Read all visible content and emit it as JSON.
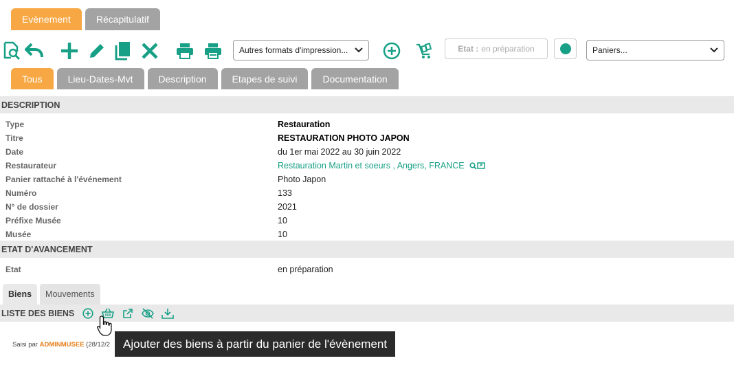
{
  "top_tabs": [
    {
      "label": "Evènement",
      "active": true
    },
    {
      "label": "Récapitulatif",
      "active": false
    }
  ],
  "toolbar": {
    "print_formats_label": "Autres formats d'impression...",
    "etat_label": "Etat :",
    "etat_value": "en préparation",
    "paniers_label": "Paniers..."
  },
  "sub_tabs": [
    {
      "label": "Tous",
      "active": true
    },
    {
      "label": "Lieu-Dates-Mvt",
      "active": false
    },
    {
      "label": "Description",
      "active": false
    },
    {
      "label": "Etapes de suivi",
      "active": false
    },
    {
      "label": "Documentation",
      "active": false
    }
  ],
  "description": {
    "header": "DESCRIPTION",
    "rows": [
      {
        "label": "Type",
        "value": "Restauration"
      },
      {
        "label": "Titre",
        "value": "RESTAURATION PHOTO JAPON"
      },
      {
        "label": "Date",
        "value": "du 1er mai 2022 au 30 juin 2022"
      },
      {
        "label": "Restaurateur",
        "value": "Restauration Martin et soeurs , Angers, FRANCE"
      },
      {
        "label": "Panier rattaché à l'événement",
        "value": "Photo Japon"
      },
      {
        "label": "Numéro",
        "value": "133"
      },
      {
        "label": "N° de dossier",
        "value": "2021"
      },
      {
        "label": "Préfixe Musée",
        "value": "10"
      },
      {
        "label": "Musée",
        "value": "10"
      }
    ]
  },
  "avancement": {
    "header": "ETAT D'AVANCEMENT",
    "rows": [
      {
        "label": "Etat",
        "value": "en préparation"
      }
    ]
  },
  "bottom_tabs": [
    {
      "label": "Biens",
      "active": true
    },
    {
      "label": "Mouvements",
      "active": false
    }
  ],
  "liste": {
    "header": "LISTE DES BIENS"
  },
  "footer": {
    "prefix": "Saisi par ",
    "user": "ADMINMUSEE",
    "date": " (28/12/2"
  },
  "tooltip": "Ajouter des biens à partir du panier de l'évènement",
  "colors": {
    "accent": "#f7a743",
    "green": "#17a086",
    "tab_gray": "#a3a3a3"
  }
}
